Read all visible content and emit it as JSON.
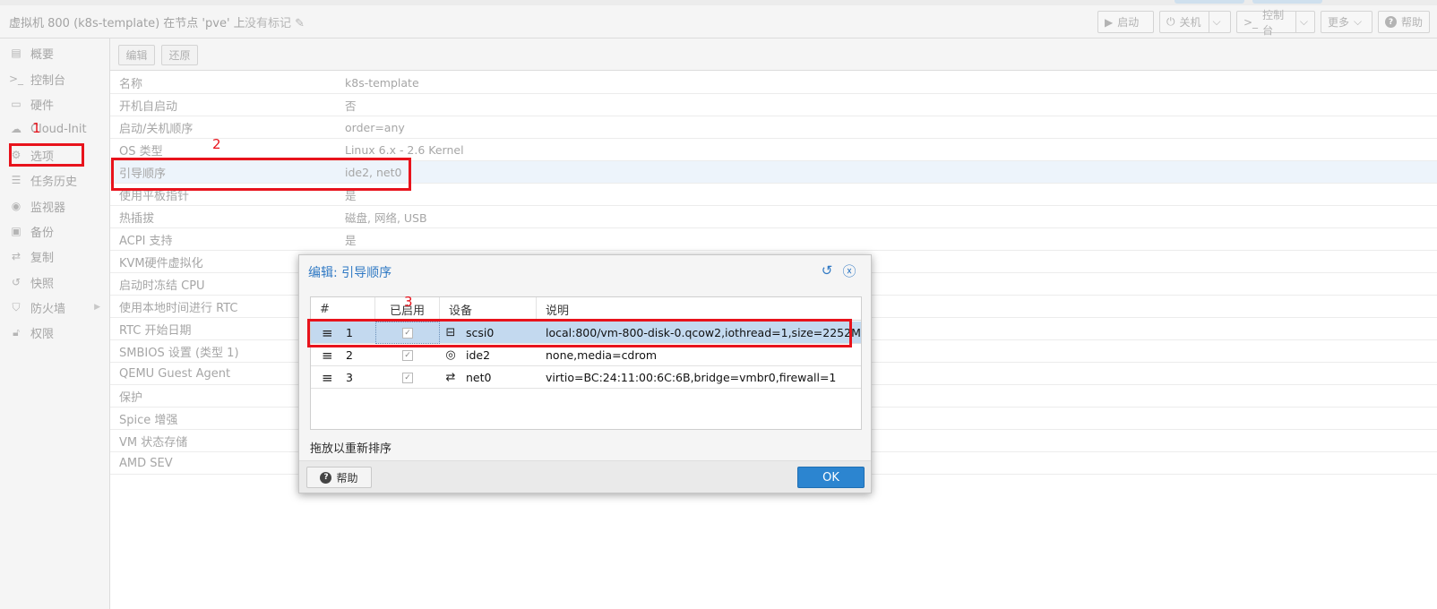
{
  "header": {
    "title": "虚拟机 800 (k8s-template) 在节点 'pve' 上",
    "tags": "没有标记",
    "buttons": {
      "start": "启动",
      "shutdown": "关机",
      "console": "控制台",
      "more": "更多",
      "help": "帮助"
    }
  },
  "sidebar": {
    "items": [
      {
        "label": "概要",
        "icon": "book-icon"
      },
      {
        "label": "控制台",
        "icon": "terminal-icon"
      },
      {
        "label": "硬件",
        "icon": "monitor-icon"
      },
      {
        "label": "Cloud-Init",
        "icon": "cloud-icon"
      },
      {
        "label": "选项",
        "icon": "gear-icon"
      },
      {
        "label": "任务历史",
        "icon": "list-icon"
      },
      {
        "label": "监视器",
        "icon": "eye-icon"
      },
      {
        "label": "备份",
        "icon": "floppy-icon"
      },
      {
        "label": "复制",
        "icon": "retweet-icon"
      },
      {
        "label": "快照",
        "icon": "history-icon"
      },
      {
        "label": "防火墙",
        "icon": "shield-icon"
      },
      {
        "label": "权限",
        "icon": "unlock-icon"
      }
    ]
  },
  "toolbar": {
    "edit": "编辑",
    "revert": "还原"
  },
  "options": [
    {
      "key": "名称",
      "value": "k8s-template"
    },
    {
      "key": "开机自启动",
      "value": "否"
    },
    {
      "key": "启动/关机顺序",
      "value": "order=any"
    },
    {
      "key": "OS 类型",
      "value": "Linux 6.x - 2.6 Kernel"
    },
    {
      "key": "引导顺序",
      "value": "ide2, net0"
    },
    {
      "key": "使用平板指针",
      "value": "是"
    },
    {
      "key": "热插拔",
      "value": "磁盘, 网络, USB"
    },
    {
      "key": "ACPI 支持",
      "value": "是"
    },
    {
      "key": "KVM硬件虚拟化",
      "value": ""
    },
    {
      "key": "启动时冻结 CPU",
      "value": ""
    },
    {
      "key": "使用本地时间进行 RTC",
      "value": ""
    },
    {
      "key": "RTC 开始日期",
      "value": ""
    },
    {
      "key": "SMBIOS 设置 (类型 1)",
      "value": ""
    },
    {
      "key": "QEMU Guest Agent",
      "value": ""
    },
    {
      "key": "保护",
      "value": ""
    },
    {
      "key": "Spice 增强",
      "value": ""
    },
    {
      "key": "VM 状态存储",
      "value": ""
    },
    {
      "key": "AMD SEV",
      "value": ""
    }
  ],
  "annotations": {
    "n1": "1",
    "n2": "2",
    "n3": "3",
    "accent": "#e8131c"
  },
  "dialog": {
    "title": "编辑: 引导顺序",
    "columns": {
      "num": "#",
      "enabled": "已启用",
      "device": "设备",
      "description": "说明"
    },
    "rows": [
      {
        "num": "1",
        "enabled": true,
        "device": "scsi0",
        "device_icon": "hdd-icon",
        "description": "local:800/vm-800-disk-0.qcow2,iothread=1,size=2252M"
      },
      {
        "num": "2",
        "enabled": true,
        "device": "ide2",
        "device_icon": "cdrom-icon",
        "description": "none,media=cdrom"
      },
      {
        "num": "3",
        "enabled": true,
        "device": "net0",
        "device_icon": "exchange-icon",
        "description": "virtio=BC:24:11:00:6C:6B,bridge=vmbr0,firewall=1"
      }
    ],
    "hint": "拖放以重新排序",
    "help": "帮助",
    "ok": "OK"
  }
}
